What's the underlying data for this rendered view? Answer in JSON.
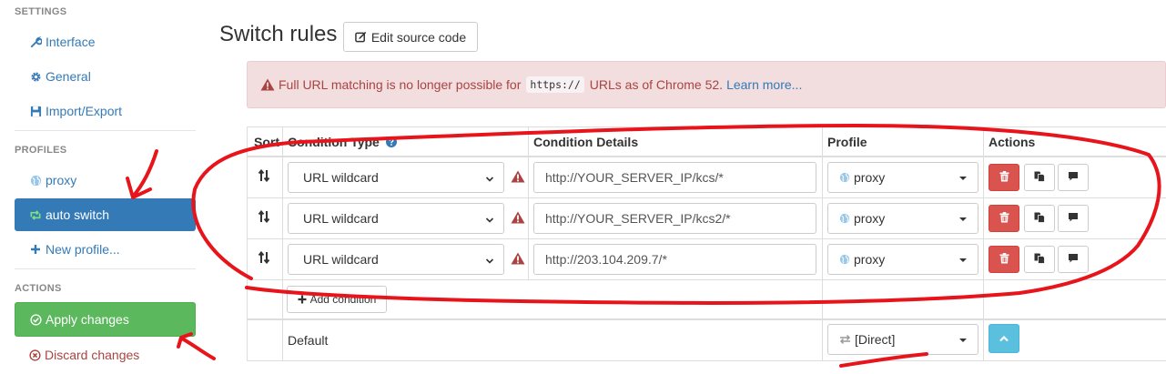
{
  "sidebar": {
    "settings_header": "SETTINGS",
    "settings_items": [
      {
        "label": "Interface",
        "icon": "wrench-icon"
      },
      {
        "label": "General",
        "icon": "gear-icon"
      },
      {
        "label": "Import/Export",
        "icon": "floppy-icon"
      }
    ],
    "profiles_header": "PROFILES",
    "profile_items": [
      {
        "label": "proxy",
        "icon": "globe-icon",
        "active": false
      },
      {
        "label": "auto switch",
        "icon": "retweet-icon",
        "active": true
      },
      {
        "label": "New profile...",
        "icon": "plus-icon",
        "active": false
      }
    ],
    "actions_header": "ACTIONS",
    "apply_label": "Apply changes",
    "discard_label": "Discard changes"
  },
  "main": {
    "title": "Switch rules",
    "edit_source_label": "Edit source code",
    "alert": {
      "text_before": "Full URL matching is no longer possible for",
      "code": "https://",
      "text_after": "URLs as of Chrome 52.",
      "link": "Learn more..."
    },
    "table": {
      "headers": {
        "sort": "Sort",
        "condition_type": "Condition Type",
        "condition_details": "Condition Details",
        "profile": "Profile",
        "actions": "Actions"
      },
      "rows": [
        {
          "condition_type": "URL wildcard",
          "condition_details": "http://YOUR_SERVER_IP/kcs/*",
          "profile": "proxy"
        },
        {
          "condition_type": "URL wildcard",
          "condition_details": "http://YOUR_SERVER_IP/kcs2/*",
          "profile": "proxy"
        },
        {
          "condition_type": "URL wildcard",
          "condition_details": "http://203.104.209.7/*",
          "profile": "proxy"
        }
      ],
      "add_condition_label": "Add condition",
      "default_label": "Default",
      "default_profile": "[Direct]"
    }
  },
  "colors": {
    "primary": "#337ab7",
    "success": "#5cb85c",
    "danger": "#d9534f",
    "alert_bg": "#f2dede",
    "alert_text": "#a94442",
    "info": "#5bc0de",
    "annotation_red": "#e8141b"
  }
}
